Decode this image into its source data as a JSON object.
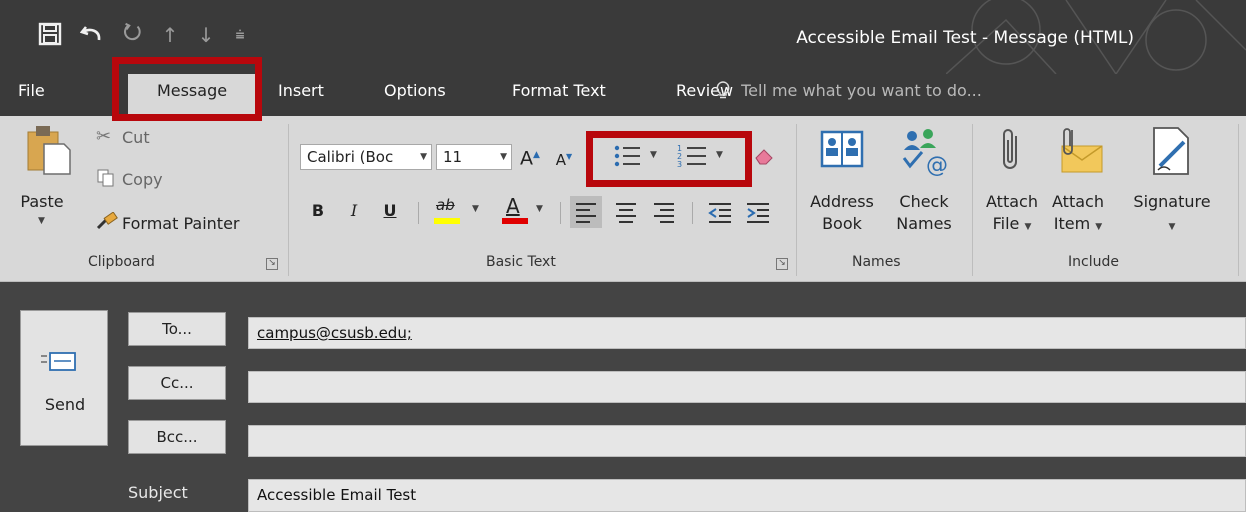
{
  "window": {
    "title": "Accessible Email Test - Message (HTML)"
  },
  "quick_access": [
    {
      "icon": "save-icon",
      "glyph": "🖫"
    },
    {
      "icon": "undo-icon",
      "glyph": "↶"
    },
    {
      "icon": "redo-icon",
      "glyph": "↻"
    },
    {
      "icon": "up-arrow-icon",
      "glyph": "↑"
    },
    {
      "icon": "down-arrow-icon",
      "glyph": "↓"
    },
    {
      "icon": "customize-qat-icon",
      "glyph": "⩧"
    }
  ],
  "tabs": {
    "file": "File",
    "message": "Message",
    "insert": "Insert",
    "options": "Options",
    "format_text": "Format Text",
    "review": "Review",
    "tell_me": "Tell me what you want to do..."
  },
  "clipboard": {
    "paste": "Paste",
    "cut": "Cut",
    "copy": "Copy",
    "format_painter": "Format Painter",
    "group_label": "Clipboard"
  },
  "basic_text": {
    "font_name": "Calibri (Boc",
    "font_size": "11",
    "grow_font": "A",
    "shrink_font": "A",
    "bold": "B",
    "italic": "I",
    "underline": "U",
    "highlight": "ab",
    "font_color": "A",
    "group_label": "Basic Text"
  },
  "names": {
    "address_book_1": "Address",
    "address_book_2": "Book",
    "check_names_1": "Check",
    "check_names_2": "Names",
    "group_label": "Names"
  },
  "include": {
    "attach_file_1": "Attach",
    "attach_file_2": "File",
    "attach_item_1": "Attach",
    "attach_item_2": "Item",
    "signature": "Signature",
    "group_label": "Include"
  },
  "compose": {
    "send": "Send",
    "to_button": "To...",
    "cc_button": "Cc...",
    "bcc_button": "Bcc...",
    "to_value": "campus@csusb.edu;",
    "cc_value": "",
    "bcc_value": "",
    "subject_label": "Subject",
    "subject_value": "Accessible Email Test"
  },
  "colors": {
    "highlight_box": "#b8070c",
    "title_bar": "#3a3a3a",
    "ribbon": "#d8d8d8",
    "highlighter_yellow": "#ffff00",
    "font_color_red": "#e00000"
  }
}
